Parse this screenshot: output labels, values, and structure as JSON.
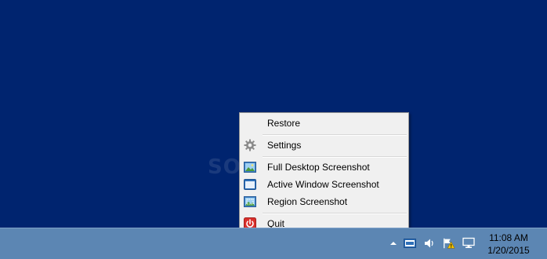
{
  "watermark": "SOFTPEDIA",
  "menu": {
    "items": [
      {
        "label": "Restore",
        "icon": "none"
      },
      {
        "label": "Settings",
        "icon": "gear-icon"
      },
      {
        "label": "Full Desktop Screenshot",
        "icon": "desktop-picture-icon"
      },
      {
        "label": "Active Window Screenshot",
        "icon": "window-icon"
      },
      {
        "label": "Region Screenshot",
        "icon": "region-picture-icon"
      },
      {
        "label": "Quit",
        "icon": "power-icon"
      }
    ]
  },
  "tray": {
    "clock_time": "11:08 AM",
    "clock_date": "1/20/2015",
    "icons": [
      "show-hidden-icons-chevron",
      "screenshot-app-icon",
      "volume-icon",
      "action-center-flag-warning-icon",
      "network-icon"
    ]
  },
  "colors": {
    "desktop": "#00246f",
    "taskbar": "#5c86b3",
    "menu_bg": "#f0f0f0",
    "quit_red": "#d9302c"
  }
}
